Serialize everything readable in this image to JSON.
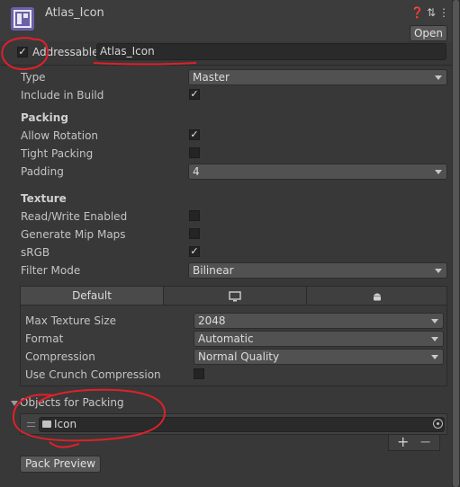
{
  "header": {
    "title": "Atlas_Icon",
    "icons": [
      "help-icon",
      "preset-icon",
      "menu-icon"
    ],
    "open_label": "Open"
  },
  "addressable": {
    "label": "Addressable",
    "checked": true,
    "address": "Atlas_Icon"
  },
  "properties": {
    "type": {
      "label": "Type",
      "value": "Master"
    },
    "include_in_build": {
      "label": "Include in Build",
      "checked": true
    }
  },
  "packing": {
    "title": "Packing",
    "allow_rotation": {
      "label": "Allow Rotation",
      "checked": true
    },
    "tight_packing": {
      "label": "Tight Packing",
      "checked": false
    },
    "padding": {
      "label": "Padding",
      "value": "4"
    }
  },
  "texture": {
    "title": "Texture",
    "read_write": {
      "label": "Read/Write Enabled",
      "checked": false
    },
    "mip_maps": {
      "label": "Generate Mip Maps",
      "checked": false
    },
    "srgb": {
      "label": "sRGB",
      "checked": true
    },
    "filter_mode": {
      "label": "Filter Mode",
      "value": "Bilinear"
    }
  },
  "platform_tabs": {
    "tabs": [
      {
        "label": "Default",
        "icon": "default-tab"
      },
      {
        "label": "",
        "icon": "monitor-icon"
      },
      {
        "label": "",
        "icon": "android-icon"
      }
    ],
    "max_texture_size": {
      "label": "Max Texture Size",
      "value": "2048"
    },
    "format": {
      "label": "Format",
      "value": "Automatic"
    },
    "compression": {
      "label": "Compression",
      "value": "Normal Quality"
    },
    "crunch": {
      "label": "Use Crunch Compression",
      "checked": false
    }
  },
  "objects_for_packing": {
    "title": "Objects for Packing",
    "items": [
      {
        "label": "Icon",
        "icon": "folder-icon"
      }
    ],
    "add_label": "+",
    "remove_label": "−"
  },
  "pack_preview_label": "Pack Preview",
  "annotation_color": "#e0202a"
}
